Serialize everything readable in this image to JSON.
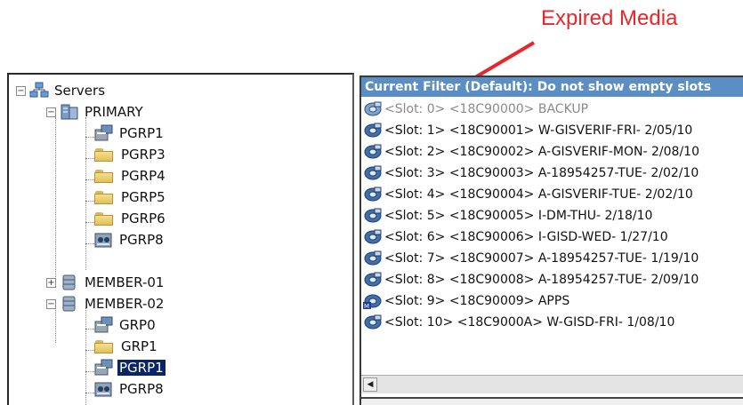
{
  "annotation": {
    "label": "Expired Media",
    "color": "#e8262b"
  },
  "tree": {
    "root": {
      "label": "Servers",
      "expander": "⊟",
      "icon": "servers-icon"
    },
    "primary": {
      "label": "PRIMARY",
      "expander": "⊟",
      "icon": "server-icon"
    },
    "primary_children": [
      {
        "label": "PGRP1",
        "icon": "policy-group-icon"
      },
      {
        "label": "PGRP3",
        "icon": "folder-icon"
      },
      {
        "label": "PGRP4",
        "icon": "folder-icon"
      },
      {
        "label": "PGRP5",
        "icon": "folder-icon"
      },
      {
        "label": "PGRP6",
        "icon": "folder-icon"
      },
      {
        "label": "PGRP8",
        "icon": "tape-group-icon"
      }
    ],
    "member01": {
      "label": "MEMBER-01",
      "expander": "⊞",
      "icon": "database-icon"
    },
    "member02": {
      "label": "MEMBER-02",
      "expander": "⊟",
      "icon": "database-icon"
    },
    "member02_children": [
      {
        "label": "GRP0",
        "icon": "policy-group-icon"
      },
      {
        "label": "GRP1",
        "icon": "folder-icon"
      },
      {
        "label": "PGRP1",
        "icon": "policy-group-icon",
        "selected": true
      },
      {
        "label": "PGRP8",
        "icon": "tape-group-icon"
      }
    ]
  },
  "slots": {
    "filter": "Current Filter (Default):  Do not show empty slots",
    "filter_color": "#5b8ec4",
    "rows": [
      {
        "text": "<Slot:  0> <18C90000> BACKUP",
        "expired": true,
        "icon": "tape-icon"
      },
      {
        "text": "<Slot:  1> <18C90001> W-GISVERIF-FRI- 2/05/10",
        "expired": false,
        "icon": "tape-icon"
      },
      {
        "text": "<Slot:  2> <18C90002> A-GISVERIF-MON- 2/08/10",
        "expired": false,
        "icon": "tape-icon"
      },
      {
        "text": "<Slot:  3> <18C90003> A-18954257-TUE- 2/02/10",
        "expired": false,
        "icon": "tape-icon"
      },
      {
        "text": "<Slot:  4> <18C90004> A-GISVERIF-TUE- 2/02/10",
        "expired": false,
        "icon": "tape-icon"
      },
      {
        "text": "<Slot:  5> <18C90005> I-DM-THU- 2/18/10",
        "expired": false,
        "icon": "tape-icon"
      },
      {
        "text": "<Slot:  6> <18C90006> I-GISD-WED- 1/27/10",
        "expired": false,
        "icon": "tape-icon"
      },
      {
        "text": "<Slot:  7> <18C90007> A-18954257-TUE- 1/19/10",
        "expired": false,
        "icon": "tape-icon"
      },
      {
        "text": "<Slot:  8> <18C90008> A-18954257-TUE- 2/09/10",
        "expired": false,
        "icon": "tape-icon"
      },
      {
        "text": "<Slot:  9> <18C90009> APPS",
        "expired": false,
        "icon": "tape-m-icon"
      },
      {
        "text": "<Slot: 10> <18C9000A> W-GISD-FRI- 1/08/10",
        "expired": false,
        "icon": "tape-icon"
      }
    ],
    "scroll_left": "◀"
  }
}
